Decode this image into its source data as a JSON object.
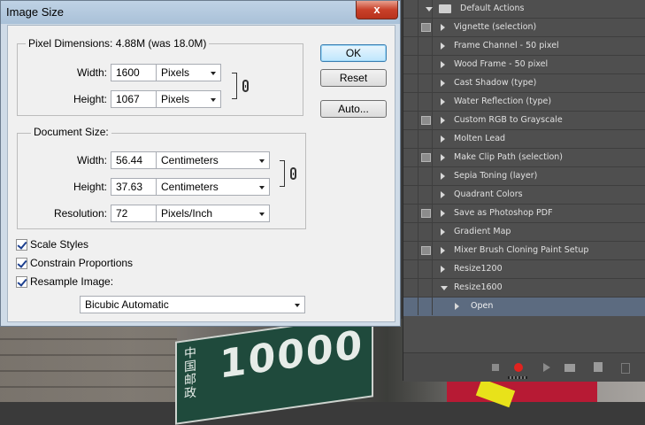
{
  "dialog": {
    "title": "Image Size",
    "close_glyph": "x",
    "pixel_dimensions": {
      "legend": "Pixel Dimensions:",
      "size_info": "4.88M (was 18.0M)",
      "width_label": "Width:",
      "width_value": "1600",
      "width_unit": "Pixels",
      "height_label": "Height:",
      "height_value": "1067",
      "height_unit": "Pixels"
    },
    "document_size": {
      "legend": "Document Size:",
      "width_label": "Width:",
      "width_value": "56.44",
      "width_unit": "Centimeters",
      "height_label": "Height:",
      "height_value": "37.63",
      "height_unit": "Centimeters",
      "resolution_label": "Resolution:",
      "resolution_value": "72",
      "resolution_unit": "Pixels/Inch"
    },
    "buttons": {
      "ok": "OK",
      "reset": "Reset",
      "auto": "Auto..."
    },
    "options": {
      "scale_styles": {
        "label": "Scale Styles",
        "checked": true
      },
      "constrain_proportions": {
        "label": "Constrain Proportions",
        "checked": true
      },
      "resample_image": {
        "label": "Resample Image:",
        "checked": true
      }
    },
    "resample_method": "Bicubic Automatic"
  },
  "actions_panel": {
    "items": [
      {
        "label": "Default Actions",
        "kind": "set",
        "expanded": true
      },
      {
        "label": "Vignette (selection)",
        "kind": "action",
        "dialog": true
      },
      {
        "label": "Frame Channel - 50 pixel",
        "kind": "action",
        "dialog": false
      },
      {
        "label": "Wood Frame - 50 pixel",
        "kind": "action",
        "dialog": false
      },
      {
        "label": "Cast Shadow (type)",
        "kind": "action",
        "dialog": false
      },
      {
        "label": "Water Reflection (type)",
        "kind": "action",
        "dialog": false
      },
      {
        "label": "Custom RGB to Grayscale",
        "kind": "action",
        "dialog": true
      },
      {
        "label": "Molten Lead",
        "kind": "action",
        "dialog": false
      },
      {
        "label": "Make Clip Path (selection)",
        "kind": "action",
        "dialog": true
      },
      {
        "label": "Sepia Toning (layer)",
        "kind": "action",
        "dialog": false
      },
      {
        "label": "Quadrant Colors",
        "kind": "action",
        "dialog": false
      },
      {
        "label": "Save as Photoshop PDF",
        "kind": "action",
        "dialog": true
      },
      {
        "label": "Gradient Map",
        "kind": "action",
        "dialog": false
      },
      {
        "label": "Mixer Brush Cloning Paint Setup",
        "kind": "action",
        "dialog": true
      },
      {
        "label": "Resize1200",
        "kind": "action",
        "dialog": false
      },
      {
        "label": "Resize1600",
        "kind": "action",
        "dialog": false,
        "expanded": true
      },
      {
        "label": "Open",
        "kind": "step",
        "dialog": false,
        "selected": true
      }
    ],
    "toolbar": [
      "stop-icon",
      "record-icon",
      "play-icon",
      "new-set-icon",
      "new-action-icon",
      "delete-icon"
    ]
  },
  "background": {
    "sign_number": "10000",
    "sign_characters": "中国邮政"
  }
}
